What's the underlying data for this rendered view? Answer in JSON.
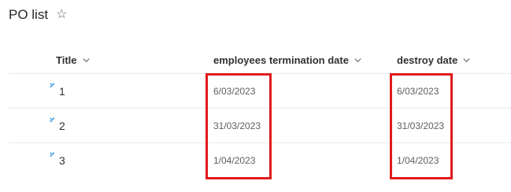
{
  "list": {
    "title": "PO list"
  },
  "columns": {
    "title": "Title",
    "termination": "employees termination date",
    "destroy": "destroy date"
  },
  "rows": [
    {
      "title": "1",
      "termination": "6/03/2023",
      "destroy": "6/03/2023"
    },
    {
      "title": "2",
      "termination": "31/03/2023",
      "destroy": "31/03/2023"
    },
    {
      "title": "3",
      "termination": "1/04/2023",
      "destroy": "1/04/2023"
    }
  ],
  "colors": {
    "highlight_box": "#e01b1b",
    "new_item_icon": "#0078d4"
  },
  "icons": {
    "favorite": "star-outline-icon",
    "sort": "chevron-down-icon",
    "new_item": "new-item-sparkle-icon"
  }
}
